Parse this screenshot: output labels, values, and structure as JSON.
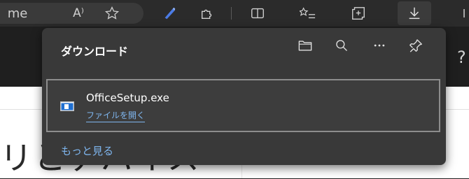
{
  "toolbar": {
    "partial_tab_text": "me",
    "read_aloud_label": "A⁾"
  },
  "panel": {
    "title": "ダウンロード",
    "more_label": "もっと見る",
    "items": [
      {
        "filename": "OfficeSetup.exe",
        "action": "ファイルを開く"
      }
    ]
  },
  "page": {
    "hero_partial": "リとデバイス",
    "help_glyph": "?"
  },
  "colors": {
    "accent_link": "#7fb6ef",
    "panel_bg": "#393939",
    "toolbar_bg": "#2b2b2b"
  }
}
